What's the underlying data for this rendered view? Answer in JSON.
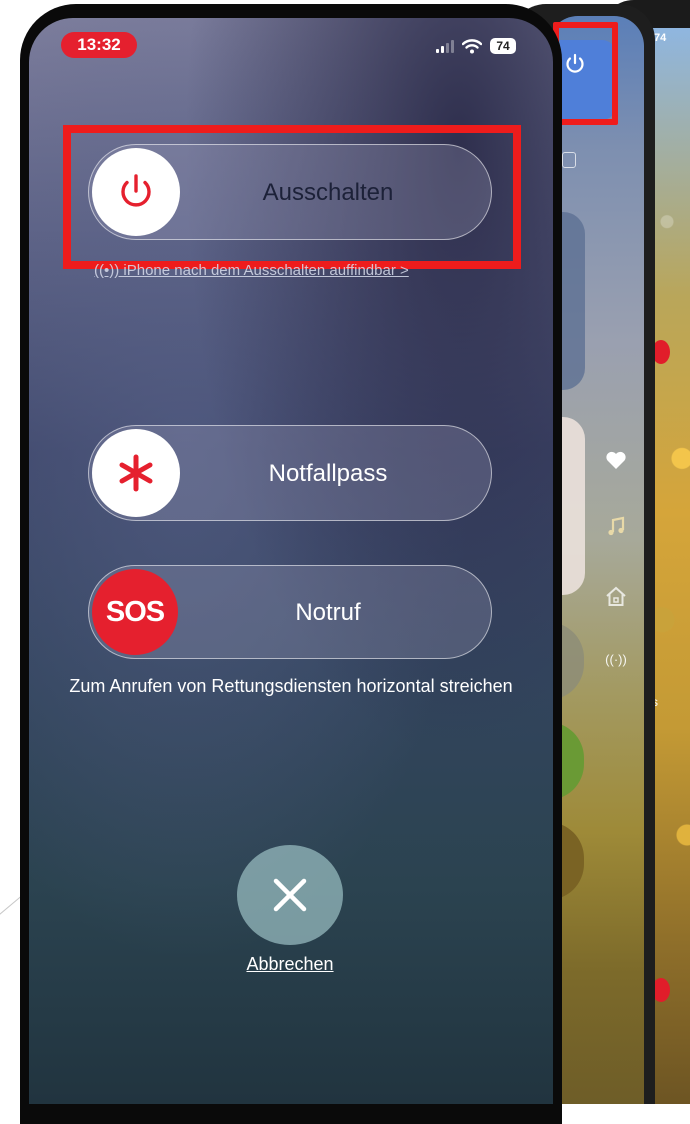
{
  "status_bar": {
    "time": "13:32",
    "battery": "74"
  },
  "power_off_screen": {
    "power_slider_label": "Ausschalten",
    "find_my_link": "((•)) iPhone nach dem Ausschalten auffindbar >",
    "medical_id_slider_label": "Notfallpass",
    "sos_knob_text": "SOS",
    "emergency_slider_label": "Notruf",
    "emergency_hint": "Zum Anrufen von Rettungsdiensten horizontal streichen",
    "cancel_label": "Abbrechen"
  },
  "background_phone": {
    "battery": "74",
    "edge_label": "s"
  },
  "icons": {
    "power": "power-icon",
    "medical": "asterisk-icon",
    "cancel": "close-icon",
    "wifi": "wifi-icon",
    "signal": "cellular-signal-icon",
    "heart": "heart-icon",
    "music": "music-note-icon",
    "home": "home-icon",
    "antenna": "broadcast-icon"
  },
  "colors": {
    "highlight_box": "#ee1c1c",
    "time_pill": "#e5202e",
    "power_icon": "#e5202e",
    "sos_knob": "#e5202e"
  }
}
